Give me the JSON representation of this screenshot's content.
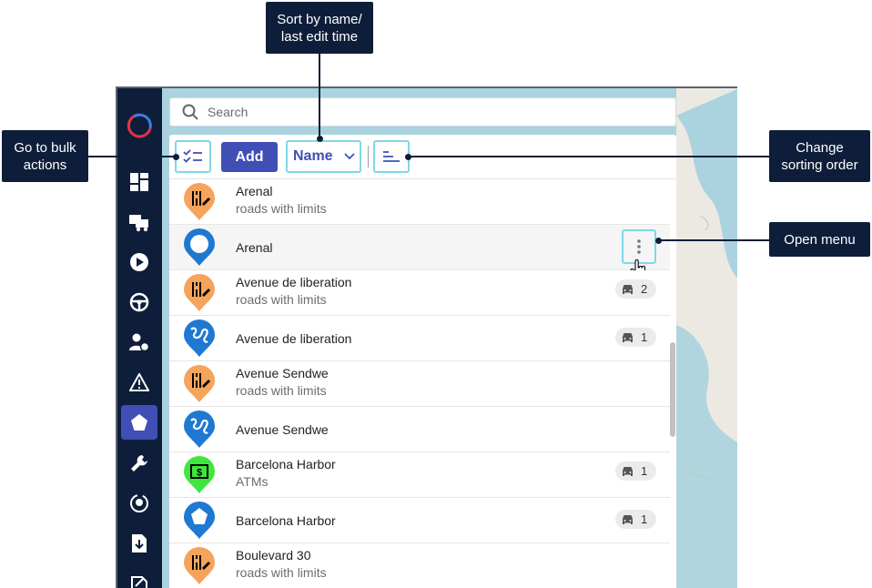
{
  "search": {
    "placeholder": "Search"
  },
  "toolbar": {
    "add_label": "Add",
    "sort_label": "Name"
  },
  "rows": [
    {
      "title": "Arenal",
      "subtitle": "roads with limits",
      "pin": "orange-road-limit-pin",
      "badge": null
    },
    {
      "title": "Arenal",
      "subtitle": "",
      "pin": "blue-circle-pin",
      "badge": null
    },
    {
      "title": "Avenue de liberation",
      "subtitle": "roads with limits",
      "pin": "orange-road-limit-pin",
      "badge": "2"
    },
    {
      "title": "Avenue de liberation",
      "subtitle": "",
      "pin": "blue-route-pin",
      "badge": "1"
    },
    {
      "title": "Avenue Sendwe",
      "subtitle": "roads with limits",
      "pin": "orange-road-limit-pin",
      "badge": null
    },
    {
      "title": "Avenue Sendwe",
      "subtitle": "",
      "pin": "blue-route-pin",
      "badge": null
    },
    {
      "title": "Barcelona Harbor",
      "subtitle": "ATMs",
      "pin": "green-atm-pin",
      "badge": "1"
    },
    {
      "title": "Barcelona Harbor",
      "subtitle": "",
      "pin": "blue-polygon-pin",
      "badge": "1"
    },
    {
      "title": "Boulevard 30",
      "subtitle": "roads with limits",
      "pin": "orange-road-limit-pin",
      "badge": null
    }
  ],
  "callouts": {
    "sort": "Sort by name/\nlast edit time",
    "bulk": "Go to bulk\nactions",
    "order": "Change\nsorting order",
    "menu": "Open menu"
  },
  "colors": {
    "sidebar": "#0e1e3a",
    "accent": "#3f4fb5",
    "highlight": "#7fd8e6",
    "orange_pin": "#f6a35c",
    "blue_pin": "#1f78d1",
    "green_pin": "#3ee63e"
  },
  "sidebar_icons": [
    "app-logo-icon",
    "dashboard-icon",
    "trucks-icon",
    "play-icon",
    "steering-wheel-icon",
    "driver-icon",
    "warning-icon",
    "geofence-icon",
    "wrench-icon",
    "location-circle-icon",
    "download-file-icon",
    "export-icon"
  ]
}
